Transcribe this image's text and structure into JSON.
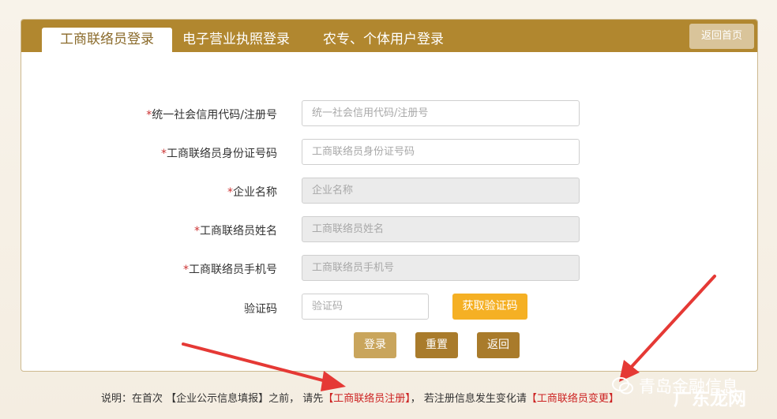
{
  "tabs": [
    {
      "label": "工商联络员登录",
      "active": true
    },
    {
      "label": "电子营业执照登录",
      "active": false
    },
    {
      "label": "农专、个体用户登录",
      "active": false
    }
  ],
  "header": {
    "home_label": "返回首页"
  },
  "form": {
    "required_mark": "*",
    "fields": [
      {
        "label": "统一社会信用代码/注册号",
        "placeholder": "统一社会信用代码/注册号",
        "disabled": false
      },
      {
        "label": "工商联络员身份证号码",
        "placeholder": "工商联络员身份证号码",
        "disabled": false
      },
      {
        "label": "企业名称",
        "placeholder": "企业名称",
        "disabled": true
      },
      {
        "label": "工商联络员姓名",
        "placeholder": "工商联络员姓名",
        "disabled": true
      },
      {
        "label": "工商联络员手机号",
        "placeholder": "工商联络员手机号",
        "disabled": true
      }
    ],
    "captcha": {
      "label": "验证码",
      "placeholder": "验证码",
      "button_label": "获取验证码"
    },
    "buttons": {
      "login": "登录",
      "reset": "重置",
      "back": "返回"
    }
  },
  "notice": {
    "prefix": "说明：在首次 【企业公示信息填报】之前， 请先",
    "link1": "【工商联络员注册】",
    "middle": "， 若注册信息发生变化请",
    "link2": "【工商联络员变更】"
  },
  "watermark": {
    "text": "青岛金融信息",
    "text2": "广东龙网"
  },
  "colors": {
    "header_brown": "#b1872f",
    "home_button": "#d9c49a",
    "captcha_button": "#f5b024",
    "login_button": "#c9a55c",
    "reset_back_button": "#a97b2b",
    "required_red": "#cc3333",
    "link_red": "#cc2222",
    "arrow_red": "#e53935"
  }
}
